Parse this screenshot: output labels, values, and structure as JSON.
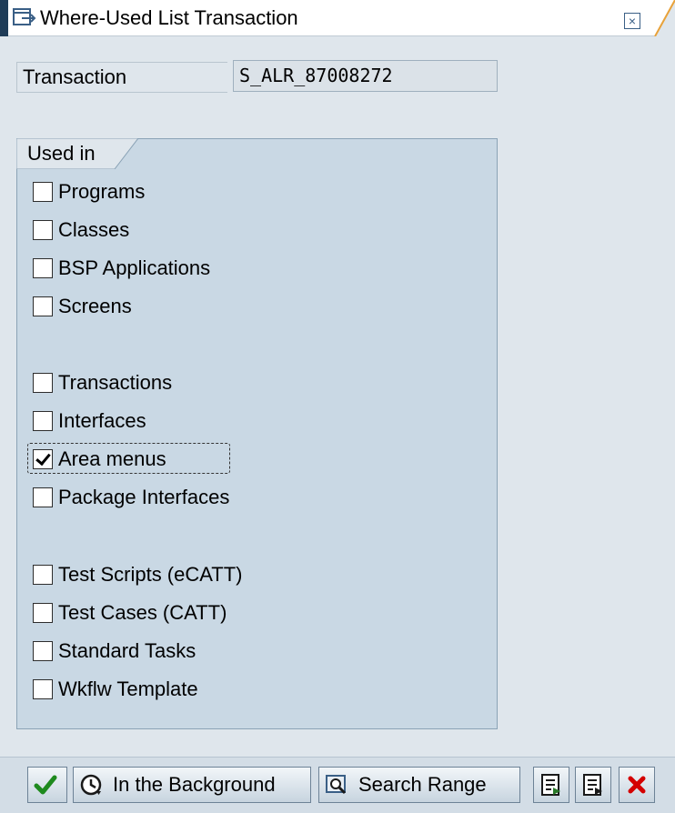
{
  "window": {
    "title": "Where-Used List Transaction",
    "close_icon": "close-icon",
    "title_icon": "dialog-icon"
  },
  "transaction": {
    "label": "Transaction",
    "value": "S_ALR_87008272"
  },
  "group": {
    "title": "Used in",
    "items": [
      {
        "label": "Programs",
        "checked": false
      },
      {
        "label": "Classes",
        "checked": false
      },
      {
        "label": "BSP Applications",
        "checked": false
      },
      {
        "label": "Screens",
        "checked": false
      },
      {
        "label": "Transactions",
        "checked": false
      },
      {
        "label": "Interfaces",
        "checked": false
      },
      {
        "label": "Area menus",
        "checked": true
      },
      {
        "label": "Package Interfaces",
        "checked": false
      },
      {
        "label": "Test Scripts (eCATT)",
        "checked": false
      },
      {
        "label": "Test Cases (CATT)",
        "checked": false
      },
      {
        "label": "Standard Tasks",
        "checked": false
      },
      {
        "label": "Wkflw Template",
        "checked": false
      }
    ]
  },
  "toolbar": {
    "continue_icon": "checkmark-icon",
    "background_label": "In the Background",
    "background_icon": "clock-icon",
    "search_range_label": "Search Range",
    "search_range_icon": "search-icon",
    "select_all_icon": "select-all-icon",
    "deselect_all_icon": "deselect-all-icon",
    "cancel_icon": "cancel-icon"
  },
  "colors": {
    "accent": "#1f3c57",
    "group_bg": "#c9d8e4",
    "cancel_red": "#d40000",
    "continue_green": "#1e8a1e"
  }
}
